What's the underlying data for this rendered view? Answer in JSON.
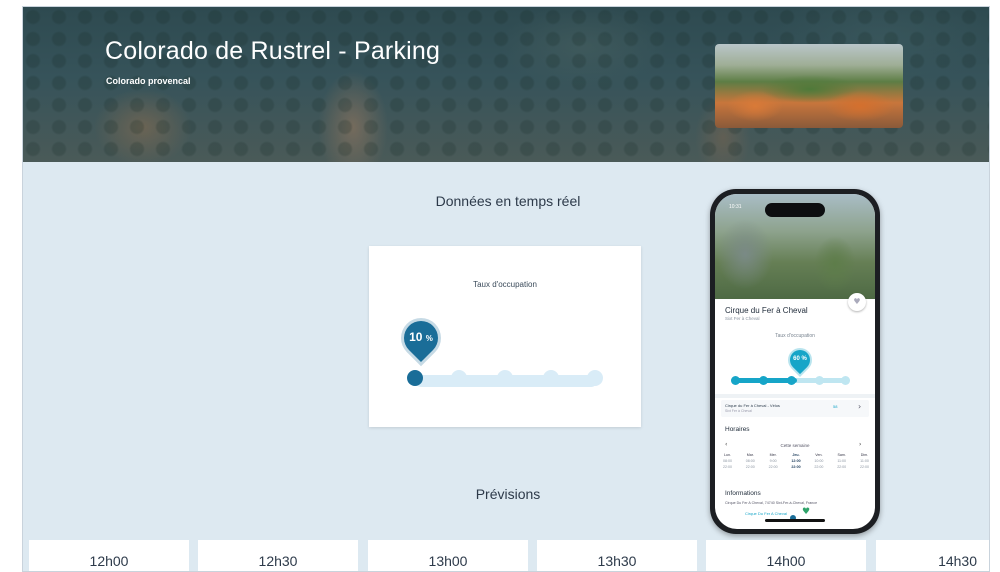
{
  "hero": {
    "title": "Colorado de Rustrel - Parking",
    "subtitle": "Colorado provencal"
  },
  "realtime": {
    "heading": "Données en temps réel",
    "occupancy_label": "Taux d'occupation",
    "occupancy_value": "10",
    "occupancy_unit": "%",
    "occupancy_percent": 10
  },
  "phone": {
    "time": "10:31",
    "place_name": "Cirque du Fer à Cheval",
    "place_sub": "Sixt Fer à Cheval",
    "occupancy_label": "Taux d'occupation",
    "occupancy_value": "60 %",
    "occupancy_percent": 60,
    "link_title": "Cirque du Fer à Cheval - Vélos",
    "link_sub": "Sixt Fer à Cheval",
    "link_value": "58",
    "link_chevron": "›",
    "hours_title": "Horaires",
    "week_label": "Cette semaine",
    "prev_arrow": "‹",
    "next_arrow": "›",
    "days": [
      {
        "day": "Lun.",
        "open": "08:00",
        "close": "22:00"
      },
      {
        "day": "Mar.",
        "open": "08:00",
        "close": "22:00"
      },
      {
        "day": "Mer.",
        "open": "9:00",
        "close": "22:00"
      },
      {
        "day": "Jeu.",
        "open": "12:00",
        "close": "22:00",
        "today": true
      },
      {
        "day": "Ven.",
        "open": "10:00",
        "close": "22:00"
      },
      {
        "day": "Sam.",
        "open": "11:00",
        "close": "22:00"
      },
      {
        "day": "Dim.",
        "open": "11:00",
        "close": "22:00"
      }
    ],
    "info_title": "Informations",
    "address": "Cirque Du Fer A Cheval, 74740 Sixt-Fer-à-Cheval, France",
    "tag": "Cirque Du Fer A Cheval"
  },
  "forecast": {
    "heading": "Prévisions",
    "slots": [
      "12h00",
      "12h30",
      "13h00",
      "13h30",
      "14h00",
      "14h30"
    ]
  },
  "colors": {
    "background": "#dde9f1",
    "primary": "#1a6d98",
    "track": "#d9ecf7",
    "phone_accent": "#16a5c8"
  }
}
